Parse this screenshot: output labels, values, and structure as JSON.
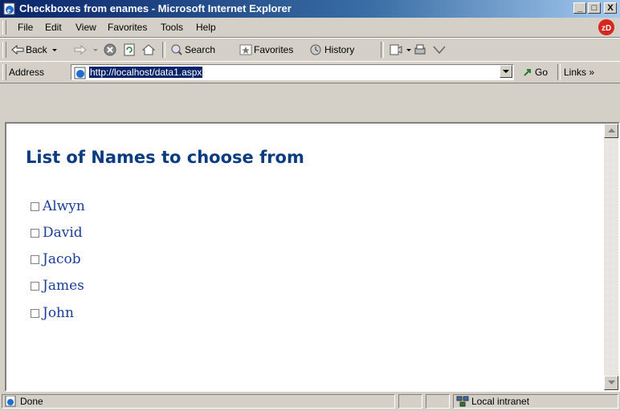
{
  "window": {
    "title": "Checkboxes from enames - Microsoft Internet Explorer",
    "controls": [
      "_",
      "□",
      "X"
    ]
  },
  "menu": {
    "items": [
      "File",
      "Edit",
      "View",
      "Favorites",
      "Tools",
      "Help"
    ],
    "mnemonics": [
      "F",
      "E",
      "V",
      "a",
      "T",
      "H"
    ]
  },
  "toolbar": {
    "back_label": "Back",
    "search_label": "Search",
    "favorites_label": "Favorites",
    "history_label": "History"
  },
  "address": {
    "label": "Address",
    "url": "http://localhost/data1.aspx",
    "go_label": "Go",
    "links_label": "Links »"
  },
  "page": {
    "heading": "List of Names to choose from",
    "options": [
      {
        "label": "Alwyn",
        "checked": false
      },
      {
        "label": "David",
        "checked": false
      },
      {
        "label": "Jacob",
        "checked": false
      },
      {
        "label": "James",
        "checked": false
      },
      {
        "label": "John",
        "checked": false
      }
    ]
  },
  "status": {
    "text": "Done",
    "zone": "Local intranet"
  },
  "colors": {
    "heading": "#0b3b80",
    "option_text": "#1a3e9a",
    "title_bar": "#0a246a"
  }
}
